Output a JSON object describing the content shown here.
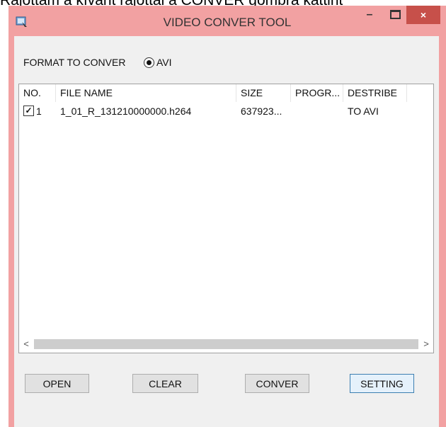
{
  "caption": "Rájöttám a kívánt rájöttál a CONVER gombra kattint",
  "window": {
    "title": "VIDEO CONVER TOOL",
    "controls": {
      "minimize": "–",
      "maximize": "□",
      "close": "×"
    }
  },
  "format": {
    "label": "FORMAT TO CONVER",
    "option": "AVI",
    "selected": true
  },
  "list": {
    "columns": [
      "NO.",
      "FILE NAME",
      "SIZE",
      "PROGR...",
      "DESTRIBE"
    ],
    "rows": [
      {
        "checked": true,
        "no": "1",
        "file_name": "1_01_R_131210000000.h264",
        "size": "637923...",
        "progress": "",
        "destribe": "TO AVI"
      }
    ],
    "scroll_left": "<",
    "scroll_right": ">"
  },
  "buttons": {
    "open": "OPEN",
    "clear": "CLEAR",
    "conver": "CONVER",
    "setting": "SETTING"
  },
  "colors": {
    "window_frame": "#f2a1a2",
    "close_button": "#c7504a",
    "client_bg": "#f0f0f0"
  }
}
